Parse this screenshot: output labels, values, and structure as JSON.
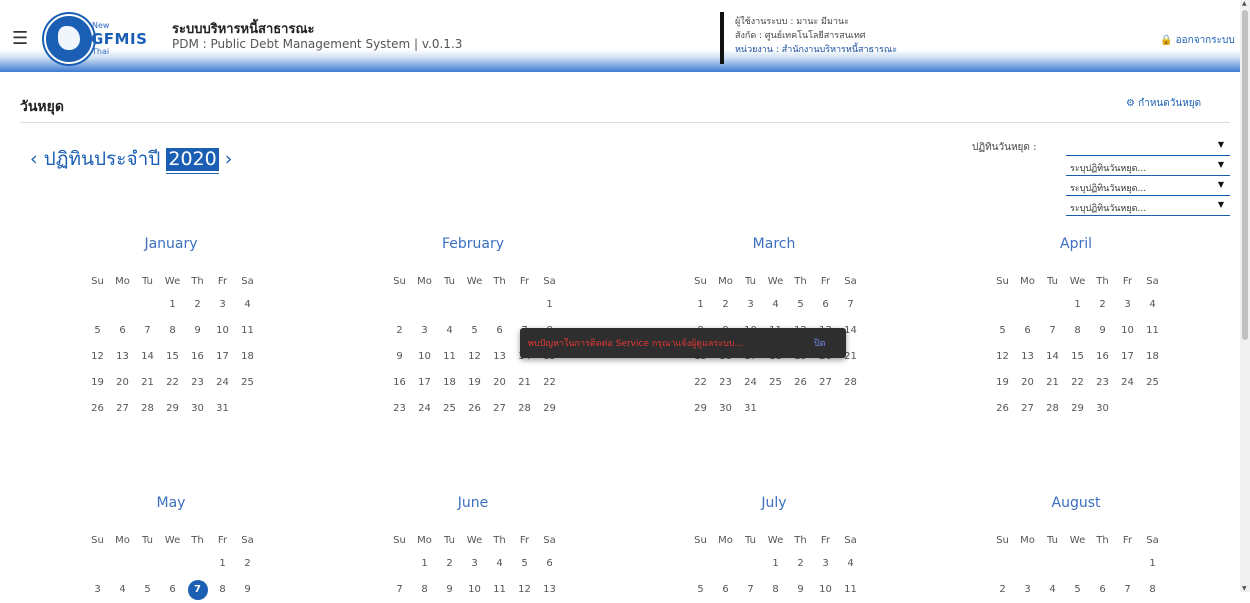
{
  "header": {
    "logo": {
      "new": "New",
      "name": "GFMIS",
      "sub": "Thai"
    },
    "title": "ระบบบริหารหนี้สาธารณะ",
    "subtitle": "PDM : Public Debt Management System | v.0.1.3",
    "user_line": "ผู้ใช้งานระบบ : มานะ มีมานะ",
    "org_line": "สังกัด : ศูนย์เทคโนโลยีสารสนเทศ",
    "unit_line": "หน่วยงาน : สำนักงานบริหารหนี้สาธารณะ",
    "logout": "ออกจากระบบ"
  },
  "page": {
    "title": "วันหยุด",
    "set_holiday": "กำหนดวันหยุด"
  },
  "calendar": {
    "prefix": "ปฏิทินประจำปี",
    "year": "2020",
    "filter_label": "ปฏิทินวันหยุด :",
    "selects": [
      "",
      "ระบุปฏิทินวันหยุด...",
      "ระบุปฏิทินวันหยุด...",
      "ระบุปฏิทินวันหยุด..."
    ],
    "dow": [
      "Su",
      "Mo",
      "Tu",
      "We",
      "Th",
      "Fr",
      "Sa"
    ],
    "months": [
      {
        "name": "January",
        "start": 3,
        "days": 31,
        "rows": 5
      },
      {
        "name": "February",
        "start": 6,
        "days": 29,
        "rows": 5
      },
      {
        "name": "March",
        "start": 0,
        "days": 31,
        "rows": 5
      },
      {
        "name": "April",
        "start": 3,
        "days": 30,
        "rows": 5
      },
      {
        "name": "May",
        "start": 5,
        "days": 9,
        "rows": 2,
        "today": 7
      },
      {
        "name": "June",
        "start": 1,
        "days": 13,
        "rows": 2
      },
      {
        "name": "July",
        "start": 3,
        "days": 11,
        "rows": 2
      },
      {
        "name": "August",
        "start": 6,
        "days": 8,
        "rows": 2
      }
    ]
  },
  "toast": {
    "message": "พบปัญหาในการติดต่อ Service กรุณาแจ้งผู้ดูแลระบบ...",
    "close": "ปิด"
  },
  "icons": {
    "menu": "hamburger-icon",
    "logout": "lock-icon",
    "settings": "gear-icon",
    "prev": "chevron-left-icon",
    "next": "chevron-right-icon"
  },
  "colors": {
    "accent": "#1a5fb4",
    "toast_bg": "#2e2e2e",
    "toast_text": "#e53935"
  }
}
